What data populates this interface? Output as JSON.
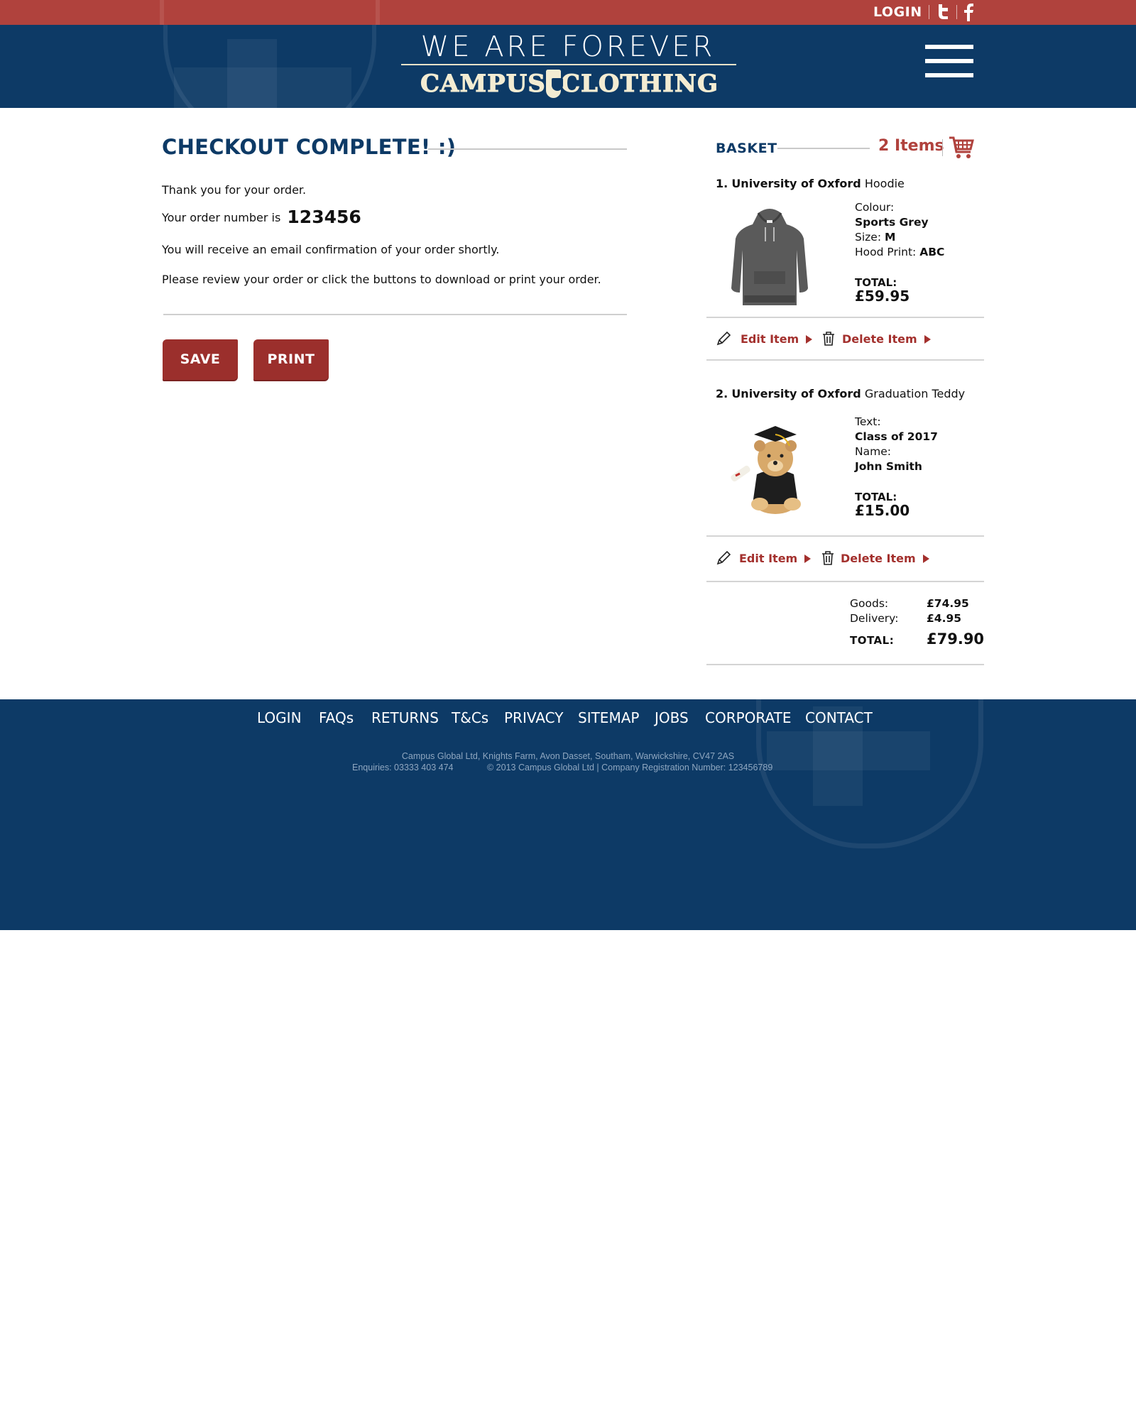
{
  "topbar": {
    "login": "LOGIN",
    "twitter_glyph": "t",
    "facebook_glyph": "f",
    "icons": [
      "twitter-icon",
      "facebook-icon"
    ]
  },
  "header": {
    "logo_line1": "WE ARE FOREVER",
    "logo_word1": "CAMPUS",
    "logo_word2": "CLOTHING",
    "menu_icon": "hamburger-menu-icon"
  },
  "checkout": {
    "title": "CHECKOUT COMPLETE! :)",
    "thanks": "Thank you for your order.",
    "order_number_prefix": "Your order number is",
    "order_number": "123456",
    "email_notice": "You will receive an email confirmation of your order shortly.",
    "review_notice": "Please review your order or click the buttons to download or print your order.",
    "save_label": "SAVE",
    "print_label": "PRINT"
  },
  "basket": {
    "label": "BASKET",
    "count": "2 Items",
    "items": [
      {
        "index": "1.",
        "university": "University of Oxford",
        "product": "Hoodie",
        "detail1_label": "Colour:",
        "detail1_value": "Sports Grey",
        "detail2_label": "Size:",
        "detail2_value": "M",
        "detail3_label": "Hood Print:",
        "detail3_value": "ABC",
        "total_label": "TOTAL:",
        "total": "£59.95",
        "edit_label": "Edit Item",
        "delete_label": "Delete Item"
      },
      {
        "index": "2.",
        "university": "University of Oxford",
        "product": "Graduation Teddy",
        "detail1_label": "Text:",
        "detail1_value": "Class of 2017",
        "detail2_label": "Name:",
        "detail2_value": "John Smith",
        "total_label": "TOTAL:",
        "total": "£15.00",
        "edit_label": "Edit Item",
        "delete_label": "Delete Item"
      }
    ],
    "summary": {
      "goods_label": "Goods:",
      "goods": "£74.95",
      "delivery_label": "Delivery:",
      "delivery": "£4.95",
      "total_label": "TOTAL:",
      "total": "£79.90"
    }
  },
  "footer": {
    "nav": [
      "LOGIN",
      "FAQs",
      "RETURNS",
      "T&Cs",
      "PRIVACY",
      "SITEMAP",
      "JOBS",
      "CORPORATE",
      "CONTACT"
    ],
    "address": "Campus Global Ltd, Knights Farm, Avon Dasset, Southam, Warwickshire, CV47 2AS",
    "enquiries": "Enquiries: 03333 403 474",
    "copyright": "© 2013 Campus Global Ltd | Company Registration Number: 123456789"
  },
  "colors": {
    "navy": "#0d3a66",
    "red": "#b0423d",
    "button": "#9b2f2c",
    "accent_text": "#a3302d"
  }
}
